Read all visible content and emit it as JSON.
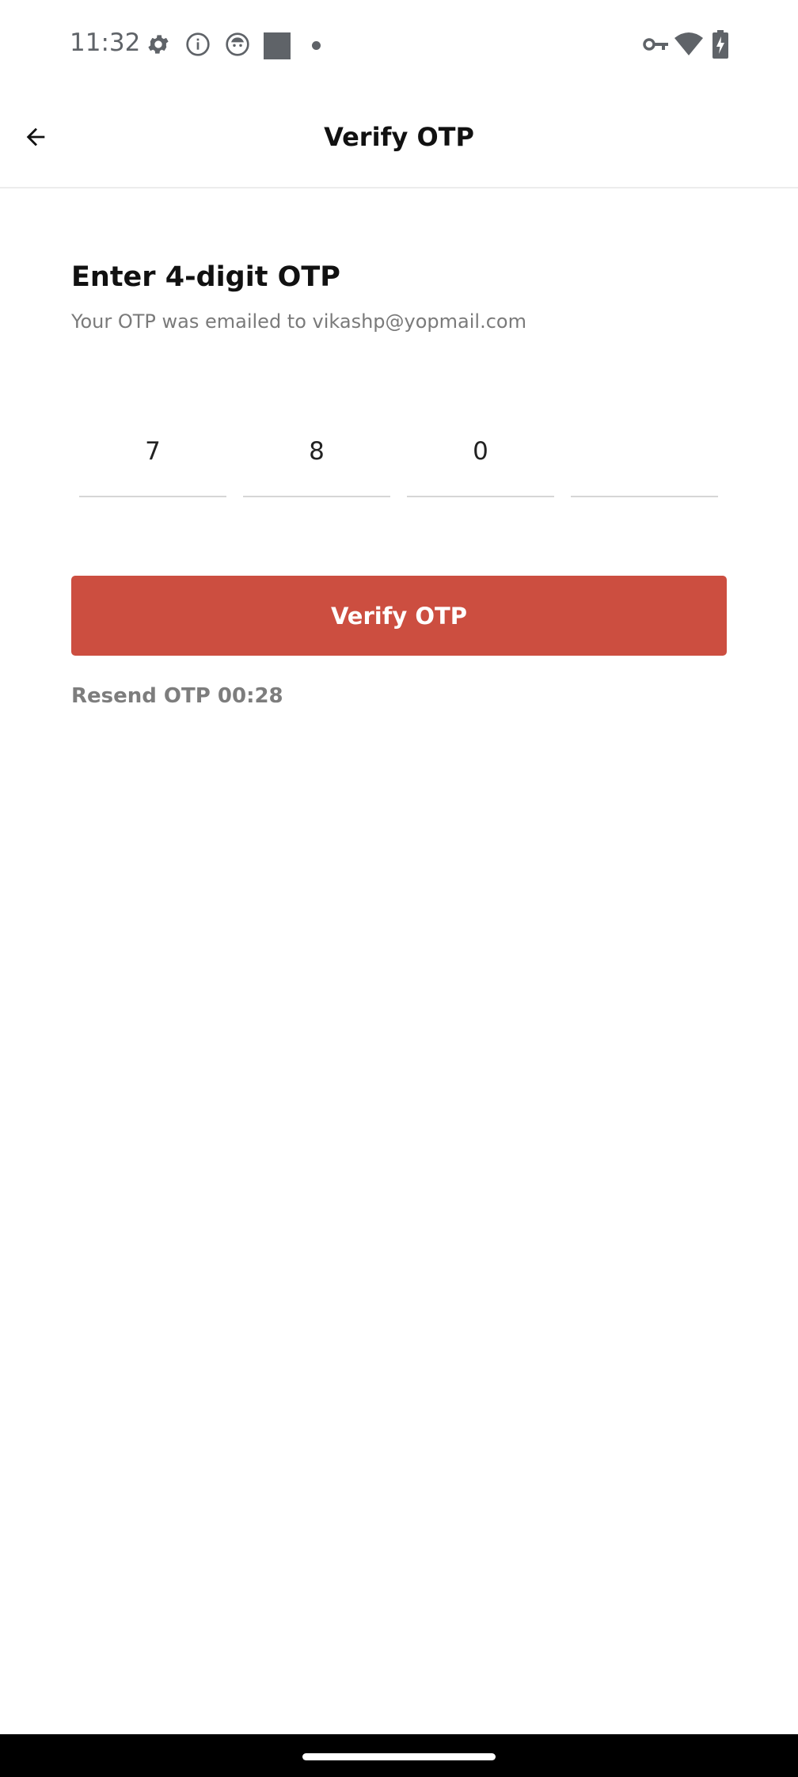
{
  "status_bar": {
    "time": "11:32",
    "left_icons": [
      "gear-icon",
      "info-icon",
      "face-icon",
      "square-icon",
      "dot-icon"
    ],
    "right_icons": [
      "vpn-key-icon",
      "wifi-icon",
      "battery-charging-icon"
    ]
  },
  "app_bar": {
    "title": "Verify OTP",
    "back_icon": "arrow-left-icon"
  },
  "content": {
    "heading": "Enter 4-digit OTP",
    "subtitle": "Your OTP was emailed to vikashp@yopmail.com",
    "otp_digits": [
      "7",
      "8",
      "0",
      ""
    ],
    "verify_button_label": "Verify OTP",
    "resend_label": "Resend OTP 00:28"
  },
  "colors": {
    "accent": "#cc4e40",
    "muted_text": "#7a7a7a",
    "divider": "#d6d6d6"
  }
}
